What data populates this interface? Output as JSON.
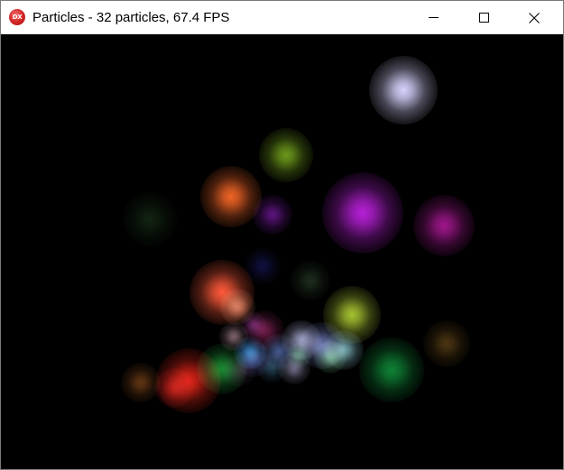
{
  "window": {
    "title": "Particles - 32 particles, 67.4 FPS",
    "app_icon_label": "DX",
    "app_icon_color": "#d22424",
    "title_bar_color": "#ffffff",
    "client_background": "#000000"
  },
  "caption_buttons": {
    "minimize_icon": "minimize-icon",
    "maximize_icon": "maximize-icon",
    "close_icon": "close-icon"
  },
  "particles": [
    {
      "color": "#d8d4ff",
      "intensity": 1.0
    },
    {
      "color": "#7fb31f",
      "intensity": 0.85
    },
    {
      "color": "#ff6a28",
      "intensity": 0.95
    },
    {
      "color": "#7a1aa8",
      "intensity": 0.75
    },
    {
      "color": "#b820d8",
      "intensity": 1.0
    },
    {
      "color": "#b0189a",
      "intensity": 0.9
    },
    {
      "color": "#1c3a1c",
      "intensity": 0.6
    },
    {
      "color": "#1a1a6a",
      "intensity": 0.6
    },
    {
      "color": "#2f4a2f",
      "intensity": 0.6
    },
    {
      "color": "#ff5a3a",
      "intensity": 1.0
    },
    {
      "color": "#ff8a6a",
      "intensity": 0.8
    },
    {
      "color": "#b8d836",
      "intensity": 0.9
    },
    {
      "color": "#a02868",
      "intensity": 0.7
    },
    {
      "color": "#c8ccff",
      "intensity": 0.75
    },
    {
      "color": "#9aa8ff",
      "intensity": 0.7
    },
    {
      "color": "#6a88d8",
      "intensity": 0.65
    },
    {
      "color": "#6c68c8",
      "intensity": 0.6
    },
    {
      "color": "#2a8ad0",
      "intensity": 0.8
    },
    {
      "color": "#9adfe8",
      "intensity": 0.75
    },
    {
      "color": "#7ad090",
      "intensity": 0.7
    },
    {
      "color": "#1fa03a",
      "intensity": 0.85
    },
    {
      "color": "#10903a",
      "intensity": 0.9
    },
    {
      "color": "#e02418",
      "intensity": 1.0
    },
    {
      "color": "#c01818",
      "intensity": 0.8
    },
    {
      "color": "#8a4a1a",
      "intensity": 0.7
    },
    {
      "color": "#6a4a18",
      "intensity": 0.7
    },
    {
      "color": "#4a2a48",
      "intensity": 0.6
    },
    {
      "color": "#b8b0e0",
      "intensity": 0.6
    },
    {
      "color": "#e0b0c0",
      "intensity": 0.55
    },
    {
      "color": "#3a6a88",
      "intensity": 0.6
    },
    {
      "color": "#9a3a9a",
      "intensity": 0.55
    },
    {
      "color": "#7ae0b0",
      "intensity": 0.55
    }
  ]
}
